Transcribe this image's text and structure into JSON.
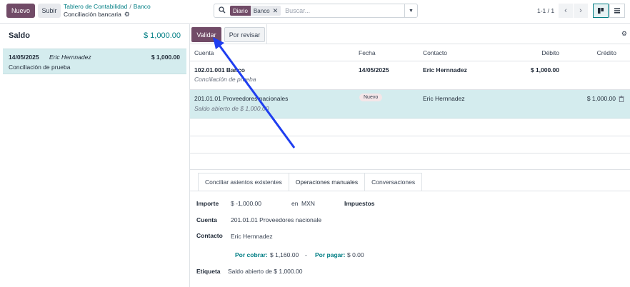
{
  "topbar": {
    "new_label": "Nuevo",
    "upload_label": "Subir",
    "breadcrumb_parent": "Tablero de Contabilidad",
    "breadcrumb_sep": "/",
    "breadcrumb_journal": "Banco",
    "current": "Conciliación bancaria",
    "search": {
      "facet_name": "Diario",
      "facet_value": "Banco",
      "placeholder": "Buscar..."
    },
    "pager": "1-1 / 1"
  },
  "left": {
    "balance_label": "Saldo",
    "balance_value": "$ 1,000.00",
    "statement": {
      "date": "14/05/2025",
      "partner": "Eric Hernnadez",
      "amount": "$ 1,000.00",
      "ref": "Conciliación de prueba"
    }
  },
  "toolbar": {
    "validate_label": "Validar",
    "review_label": "Por revisar"
  },
  "grid": {
    "headers": [
      "Cuenta",
      "Fecha",
      "Contacto",
      "Débito",
      "Crédito"
    ],
    "rows": [
      {
        "account": "102.01.001 Banco",
        "label": "Conciliación de prueba",
        "date": "14/05/2025",
        "partner": "Eric Hernnadez",
        "debit": "$ 1,000.00",
        "credit": ""
      },
      {
        "account": "201.01.01 Proveedores nacionales",
        "label": "Saldo abierto de $ 1,000.00",
        "badge": "Nuevo",
        "partner": "Eric Hernnadez",
        "debit": "",
        "credit": "$ 1,000.00"
      }
    ]
  },
  "tabs": [
    "Conciliar asientos existentes",
    "Operaciones manuales",
    "Conversaciones"
  ],
  "form": {
    "amount_label": "Importe",
    "amount_value": "$ -1,000.00",
    "currency_in": "en",
    "currency": "MXN",
    "taxes_label": "Impuestos",
    "account_label": "Cuenta",
    "account_value": "201.01.01 Proveedores nacionale",
    "partner_label": "Contacto",
    "partner_value": "Eric Hernnadez",
    "receivable_label": "Por cobrar:",
    "receivable_value": "$ 1,160.00",
    "dash": "-",
    "payable_label": "Por pagar:",
    "payable_value": "$ 0.00",
    "label_label": "Etiqueta",
    "label_value": "Saldo abierto de $ 1,000.00"
  },
  "icons": {
    "search": "search-icon",
    "gear": "gear-icon",
    "close": "close-icon",
    "caret": "caret-down-icon",
    "prev": "chevron-left-icon",
    "next": "chevron-right-icon",
    "kanban": "kanban-view-icon",
    "list": "list-view-icon",
    "trash": "trash-icon"
  },
  "colors": {
    "primary": "#714b67",
    "accent": "#017e84",
    "selected_row": "#d4ecee",
    "annotation_arrow": "#1f3ef0"
  }
}
